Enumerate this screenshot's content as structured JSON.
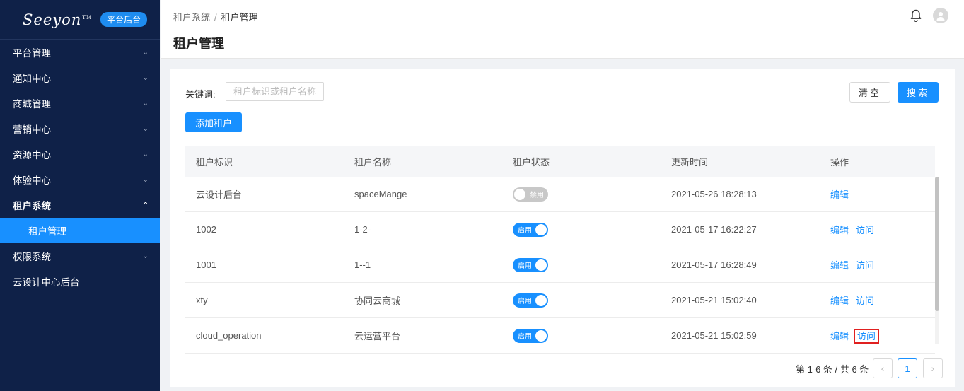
{
  "brand": {
    "logo_text": "Seeyon",
    "tm": "TM",
    "badge": "平台后台"
  },
  "sidebar": {
    "items": [
      {
        "label": "平台管理",
        "chevron": "⌄"
      },
      {
        "label": "通知中心",
        "chevron": "⌄"
      },
      {
        "label": "商城管理",
        "chevron": "⌄"
      },
      {
        "label": "营销中心",
        "chevron": "⌄"
      },
      {
        "label": "资源中心",
        "chevron": "⌄"
      },
      {
        "label": "体验中心",
        "chevron": "⌄"
      },
      {
        "label": "租户系统",
        "chevron": "⌃"
      },
      {
        "label": "权限系统",
        "chevron": "⌄"
      },
      {
        "label": "云设计中心后台",
        "chevron": ""
      }
    ],
    "sub_active": "租户管理"
  },
  "header": {
    "breadcrumb": [
      "租户系统",
      "租户管理"
    ],
    "separator": "/",
    "title": "租户管理"
  },
  "search": {
    "label": "关键词:",
    "placeholder": "租户标识或租户名称",
    "value": "",
    "clear_label": "清空",
    "search_label": "搜索"
  },
  "add_button": "添加租户",
  "table": {
    "headers": [
      "租户标识",
      "租户名称",
      "租户状态",
      "更新时间",
      "操作"
    ],
    "rows": [
      {
        "id": "云设计后台",
        "name": "spaceMange",
        "status": "禁用",
        "status_on": false,
        "updated": "2021-05-26 18:28:13",
        "edit": "编辑",
        "visit": ""
      },
      {
        "id": "1002",
        "name": "1-2-",
        "status": "启用",
        "status_on": true,
        "updated": "2021-05-17 16:22:27",
        "edit": "编辑",
        "visit": "访问"
      },
      {
        "id": "1001",
        "name": "1--1",
        "status": "启用",
        "status_on": true,
        "updated": "2021-05-17 16:28:49",
        "edit": "编辑",
        "visit": "访问"
      },
      {
        "id": "xty",
        "name": "协同云商城",
        "status": "启用",
        "status_on": true,
        "updated": "2021-05-21 15:02:40",
        "edit": "编辑",
        "visit": "访问"
      },
      {
        "id": "cloud_operation",
        "name": "云运营平台",
        "status": "启用",
        "status_on": true,
        "updated": "2021-05-21 15:02:59",
        "edit": "编辑",
        "visit": "访问"
      }
    ]
  },
  "pagination": {
    "summary": "第 1-6 条 / 共 6 条",
    "prev": "‹",
    "current": "1",
    "next": "›"
  },
  "colors": {
    "sidebar_bg": "#0f2148",
    "primary": "#1890ff",
    "highlight_box": "#e02020"
  }
}
